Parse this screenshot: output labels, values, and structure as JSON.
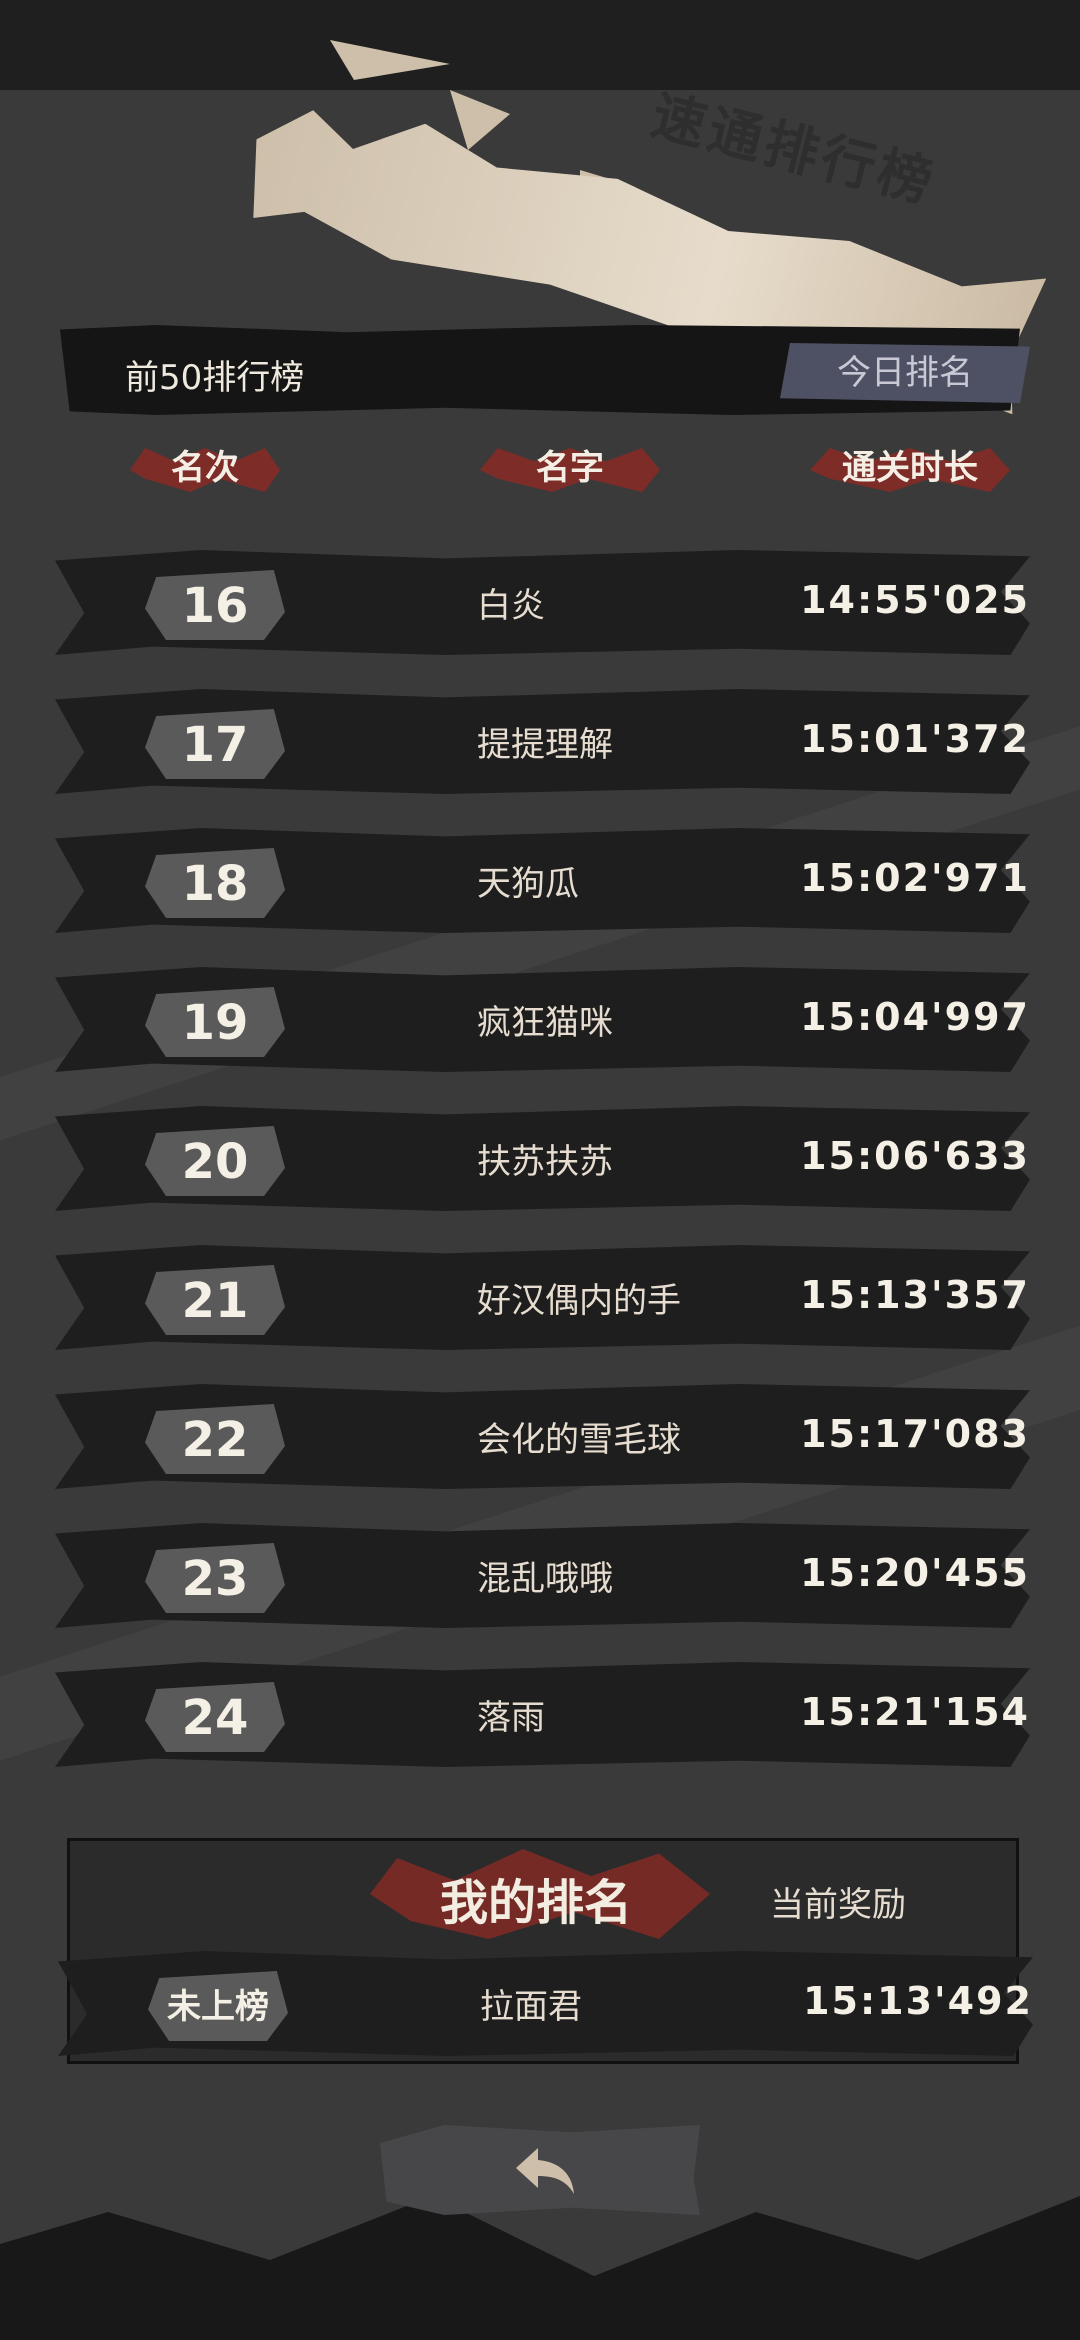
{
  "banner": {
    "title": "速通排行榜"
  },
  "header": {
    "top50_label": "前50排行榜",
    "today_button": "今日排名"
  },
  "columns": {
    "rank": "名次",
    "name": "名字",
    "time": "通关时长"
  },
  "rows": [
    {
      "rank": "16",
      "name": "白炎",
      "time": "14:55'025"
    },
    {
      "rank": "17",
      "name": "提提理解",
      "time": "15:01'372"
    },
    {
      "rank": "18",
      "name": "天狗瓜",
      "time": "15:02'971"
    },
    {
      "rank": "19",
      "name": "疯狂猫咪",
      "time": "15:04'997"
    },
    {
      "rank": "20",
      "name": "扶苏扶苏",
      "time": "15:06'633"
    },
    {
      "rank": "21",
      "name": "好汉偶内的手",
      "time": "15:13'357"
    },
    {
      "rank": "22",
      "name": "会化的雪毛球",
      "time": "15:17'083"
    },
    {
      "rank": "23",
      "name": "混乱哦哦",
      "time": "15:20'455"
    },
    {
      "rank": "24",
      "name": "落雨",
      "time": "15:21'154"
    }
  ],
  "my_rank": {
    "title": "我的排名",
    "reward_label": "当前奖励",
    "rank": "未上榜",
    "name": "拉面君",
    "time": "15:13'492"
  },
  "icons": {
    "back": "back-arrow-icon"
  },
  "colors": {
    "accent_red": "#8a2a25",
    "banner": "#e7dccb",
    "button": "#4e5164"
  }
}
